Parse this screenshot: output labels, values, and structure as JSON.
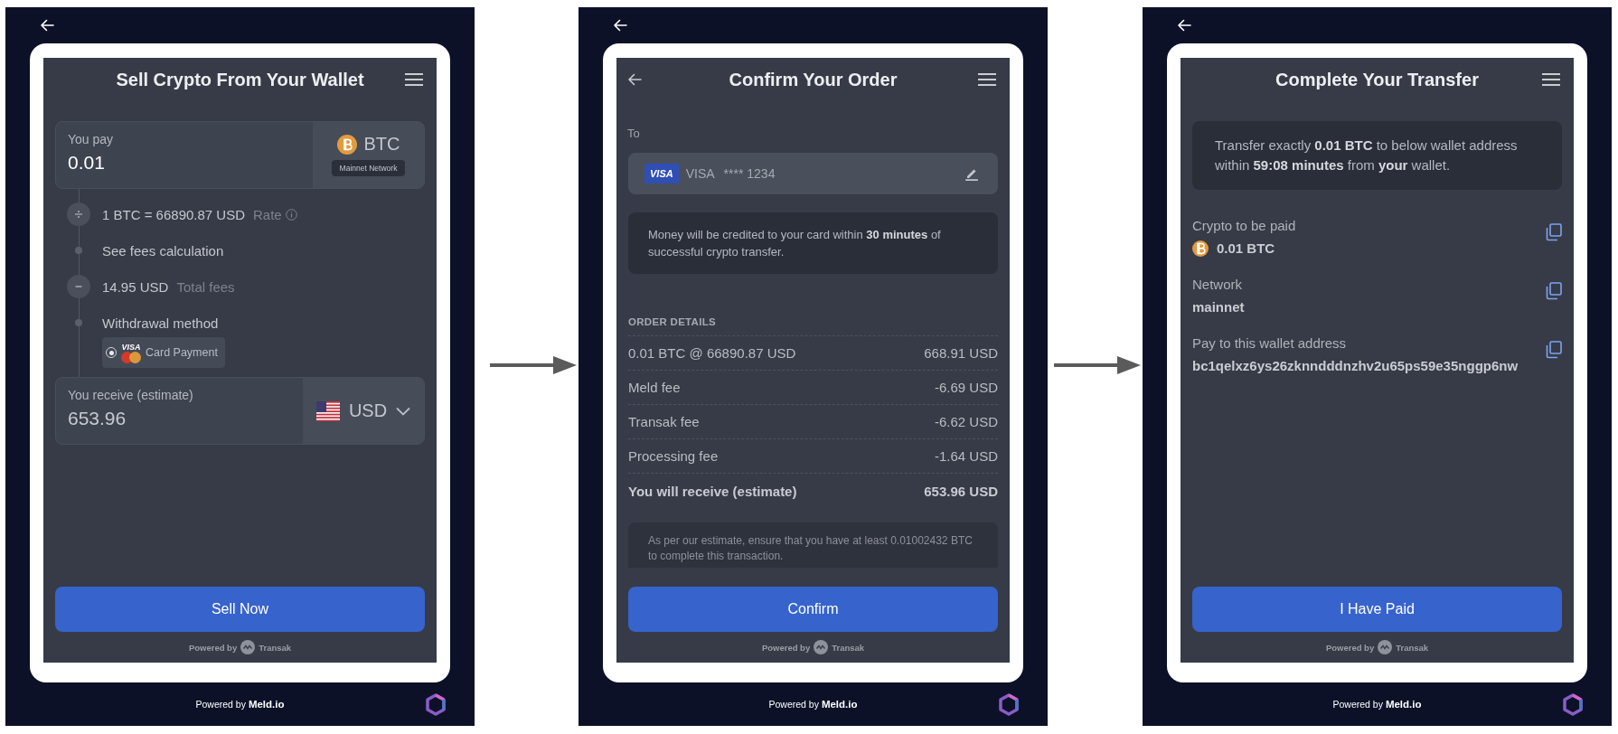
{
  "screens": [
    {
      "kind": "sell",
      "title": "Sell Crypto From Your Wallet",
      "back_button": false,
      "pay": {
        "label": "You pay",
        "value": "0.01",
        "currency": "BTC",
        "network": "Mainnet Network"
      },
      "steps": [
        {
          "kind": "rate",
          "value": "1 BTC = 66890.87 USD",
          "label": "Rate"
        },
        {
          "kind": "link",
          "value": "See fees calculation"
        },
        {
          "kind": "fees",
          "value": "14.95 USD",
          "label": "Total fees"
        },
        {
          "kind": "method",
          "value": "Withdrawal method",
          "option": {
            "brand": "VISA",
            "label": "Card Payment",
            "selected": true
          }
        }
      ],
      "receive": {
        "label": "You receive (estimate)",
        "value": "653.96",
        "currency": "USD"
      },
      "button": "Sell Now",
      "powered": {
        "prefix": "Powered by",
        "brand": "Transak"
      },
      "footer": "Powered by **Meld.io**"
    },
    {
      "kind": "confirm",
      "title": "Confirm Your Order",
      "back_button": true,
      "to_label": "To",
      "card": {
        "badge": "VISA",
        "brand": "VISA",
        "number": "**** 1234"
      },
      "info": "Money will be credited to your card within **30 minutes** of successful crypto transfer.",
      "details_title": "ORDER DETAILS",
      "details": [
        {
          "kind": "line",
          "label": "0.01 BTC @ 66890.87 USD",
          "value": "668.91 USD"
        },
        {
          "kind": "line",
          "label": "Meld fee",
          "value": "-6.69 USD"
        },
        {
          "kind": "line",
          "label": "Transak fee",
          "value": "-6.62 USD"
        },
        {
          "kind": "line",
          "label": "Processing fee",
          "value": "-1.64 USD"
        },
        {
          "kind": "total",
          "label": "You will receive (estimate)",
          "value": "653.96 USD"
        }
      ],
      "note": "As per our estimate, ensure that you have at least 0.01002432 BTC to complete this transaction.",
      "button": "Confirm",
      "powered": {
        "prefix": "Powered by",
        "brand": "Transak"
      },
      "footer": "Powered by **Meld.io**"
    },
    {
      "kind": "transfer",
      "title": "Complete Your Transfer",
      "back_button": false,
      "info": "Transfer exactly **0.01 BTC** to below wallet address within **59:08 minutes** from **your** wallet.",
      "fields": [
        {
          "kind": "coin",
          "label": "Crypto to be paid",
          "value": "0.01 BTC"
        },
        {
          "kind": "plain",
          "label": "Network",
          "value": "mainnet"
        },
        {
          "kind": "plain",
          "label": "Pay to this wallet address",
          "value": "bc1qelxz6ys26zknndddnzhv2u65ps59e35nggp6nw"
        }
      ],
      "button": "I Have Paid",
      "powered": {
        "prefix": "Powered by",
        "brand": "Transak"
      },
      "footer": "Powered by **Meld.io**"
    }
  ]
}
